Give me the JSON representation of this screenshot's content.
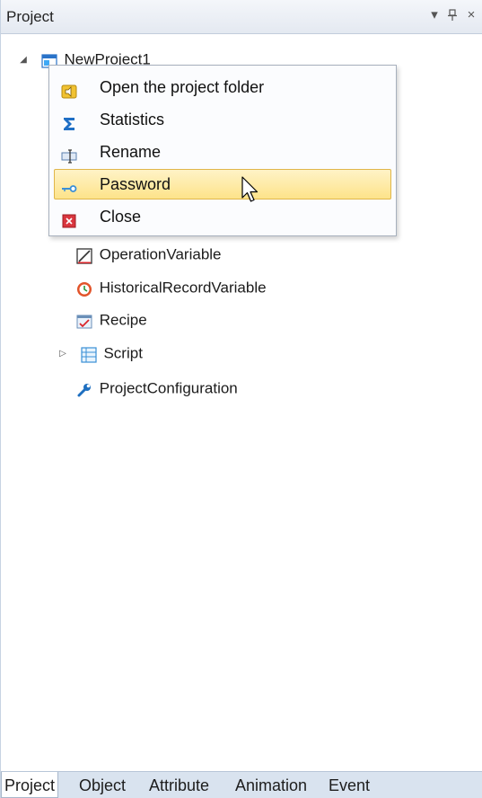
{
  "panel": {
    "title": "Project",
    "controls": {
      "dropdown": "▾",
      "pin": "ᚁ",
      "close": "×"
    }
  },
  "tree": {
    "root": {
      "label": "NewProject1",
      "expanded": true,
      "icon": "project-window-icon"
    },
    "items": [
      {
        "label": "OperationVariable",
        "icon": "operation-variable-icon"
      },
      {
        "label": "HistoricalRecordVariable",
        "icon": "historical-record-icon"
      },
      {
        "label": "Recipe",
        "icon": "recipe-icon"
      },
      {
        "label": "Script",
        "icon": "script-icon",
        "collapsed": true
      },
      {
        "label": "ProjectConfiguration",
        "icon": "wrench-icon"
      }
    ]
  },
  "context_menu": {
    "items": [
      {
        "label": "Open the project folder",
        "icon": "folder-speaker-icon"
      },
      {
        "label": "Statistics",
        "icon": "sigma-icon"
      },
      {
        "label": "Rename",
        "icon": "rename-icon"
      },
      {
        "label": "Password",
        "icon": "key-icon",
        "highlighted": true
      },
      {
        "label": "Close",
        "icon": "close-red-icon"
      }
    ]
  },
  "tabs": [
    {
      "label": "Project",
      "active": true
    },
    {
      "label": "Object"
    },
    {
      "label": "Attribute"
    },
    {
      "label": "Animation"
    },
    {
      "label": "Event"
    }
  ],
  "colors": {
    "titlebar": "#e4e9f1",
    "highlight": "#fde38a",
    "tabbar": "#d9e3ef"
  }
}
